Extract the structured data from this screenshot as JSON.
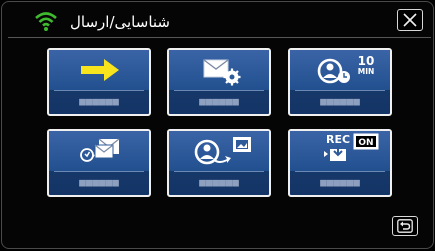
{
  "header": {
    "title": "شناسایی/ارسال",
    "wifi_icon": "wifi-signal-icon",
    "close_icon": "close-icon",
    "wifi_color": "#3fb92f"
  },
  "tiles": [
    {
      "icon": "arrow-right-icon",
      "label": "■■■■■■"
    },
    {
      "icon": "mail-settings-icon",
      "label": "■■■■■■"
    },
    {
      "icon": "person-10min-icon",
      "label": "■■■■■■"
    },
    {
      "icon": "mail-notify-icon",
      "label": "■■■■■■"
    },
    {
      "icon": "person-send-photo-icon",
      "label": "■■■■■■"
    },
    {
      "icon": "rec-on-download-icon",
      "label": "■■■■■■"
    }
  ],
  "icon_text": {
    "min_number": "10",
    "min_unit": "MIN",
    "rec": "REC",
    "on": "ON"
  },
  "footer": {
    "back_icon": "back-icon"
  }
}
